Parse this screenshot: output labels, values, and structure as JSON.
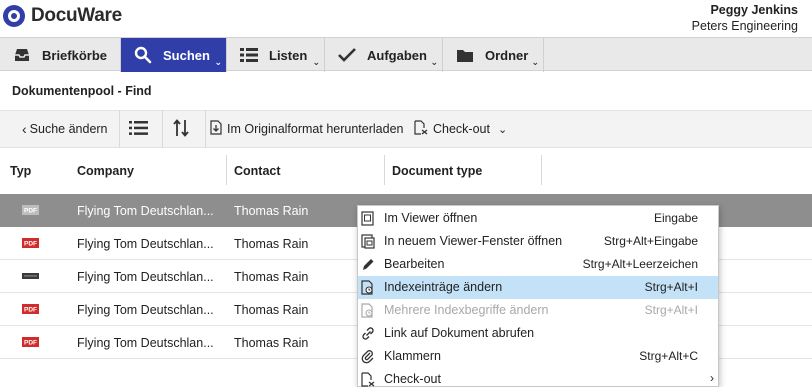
{
  "app": {
    "name": "DocuWare"
  },
  "user": {
    "name": "Peggy Jenkins",
    "company": "Peters Engineering"
  },
  "nav": {
    "items": [
      {
        "label": "Briefkörbe",
        "icon": "inbox-tray-icon",
        "active": false,
        "has_dropdown": false
      },
      {
        "label": "Suchen",
        "icon": "search-icon",
        "active": true,
        "has_dropdown": true
      },
      {
        "label": "Listen",
        "icon": "list-icon",
        "active": false,
        "has_dropdown": true
      },
      {
        "label": "Aufgaben",
        "icon": "checkmark-icon",
        "active": false,
        "has_dropdown": true
      },
      {
        "label": "Ordner",
        "icon": "folder-icon",
        "active": false,
        "has_dropdown": true
      }
    ],
    "active_color": "#2f3ea8"
  },
  "page": {
    "title": "Dokumentenpool - Find"
  },
  "toolbar": {
    "back_label": "Suche ändern",
    "download_label": "Im Originalformat herunterladen",
    "checkout_label": "Check-out"
  },
  "table": {
    "columns": [
      "Typ",
      "Company",
      "Contact",
      "Document type"
    ],
    "rows": [
      {
        "type": "pdf",
        "company": "Flying Tom Deutschlan...",
        "contact": "Thomas Rain",
        "selected": true
      },
      {
        "type": "pdf",
        "company": "Flying Tom Deutschlan...",
        "contact": "Thomas Rain",
        "selected": false
      },
      {
        "type": "doc",
        "company": "Flying Tom Deutschlan...",
        "contact": "Thomas Rain",
        "selected": false
      },
      {
        "type": "pdf",
        "company": "Flying Tom Deutschlan...",
        "contact": "Thomas Rain",
        "selected": false
      },
      {
        "type": "pdf",
        "company": "Flying Tom Deutschlan...",
        "contact": "Thomas Rain",
        "selected": false
      }
    ],
    "type_labels": {
      "pdf": "PDF"
    }
  },
  "context_menu": {
    "items": [
      {
        "label": "Im Viewer öffnen",
        "shortcut": "Eingabe",
        "icon": "viewer-icon",
        "state": "normal"
      },
      {
        "label": "In neuem Viewer-Fenster öffnen",
        "shortcut": "Strg+Alt+Eingabe",
        "icon": "new-window-icon",
        "state": "normal"
      },
      {
        "label": "Bearbeiten",
        "shortcut": "Strg+Alt+Leerzeichen",
        "icon": "pencil-icon",
        "state": "normal"
      },
      {
        "label": "Indexeinträge ändern",
        "shortcut": "Strg+Alt+I",
        "icon": "edit-index-icon",
        "state": "highlight"
      },
      {
        "label": "Mehrere Indexbegriffe ändern",
        "shortcut": "Strg+Alt+I",
        "icon": "edit-index-icon",
        "state": "disabled"
      },
      {
        "label": "Link auf Dokument abrufen",
        "shortcut": "",
        "icon": "link-icon",
        "state": "normal"
      },
      {
        "label": "Klammern",
        "shortcut": "Strg+Alt+C",
        "icon": "paperclip-icon",
        "state": "normal"
      },
      {
        "label": "Check-out",
        "shortcut": "",
        "icon": "checkout-icon",
        "state": "submenu"
      }
    ]
  }
}
